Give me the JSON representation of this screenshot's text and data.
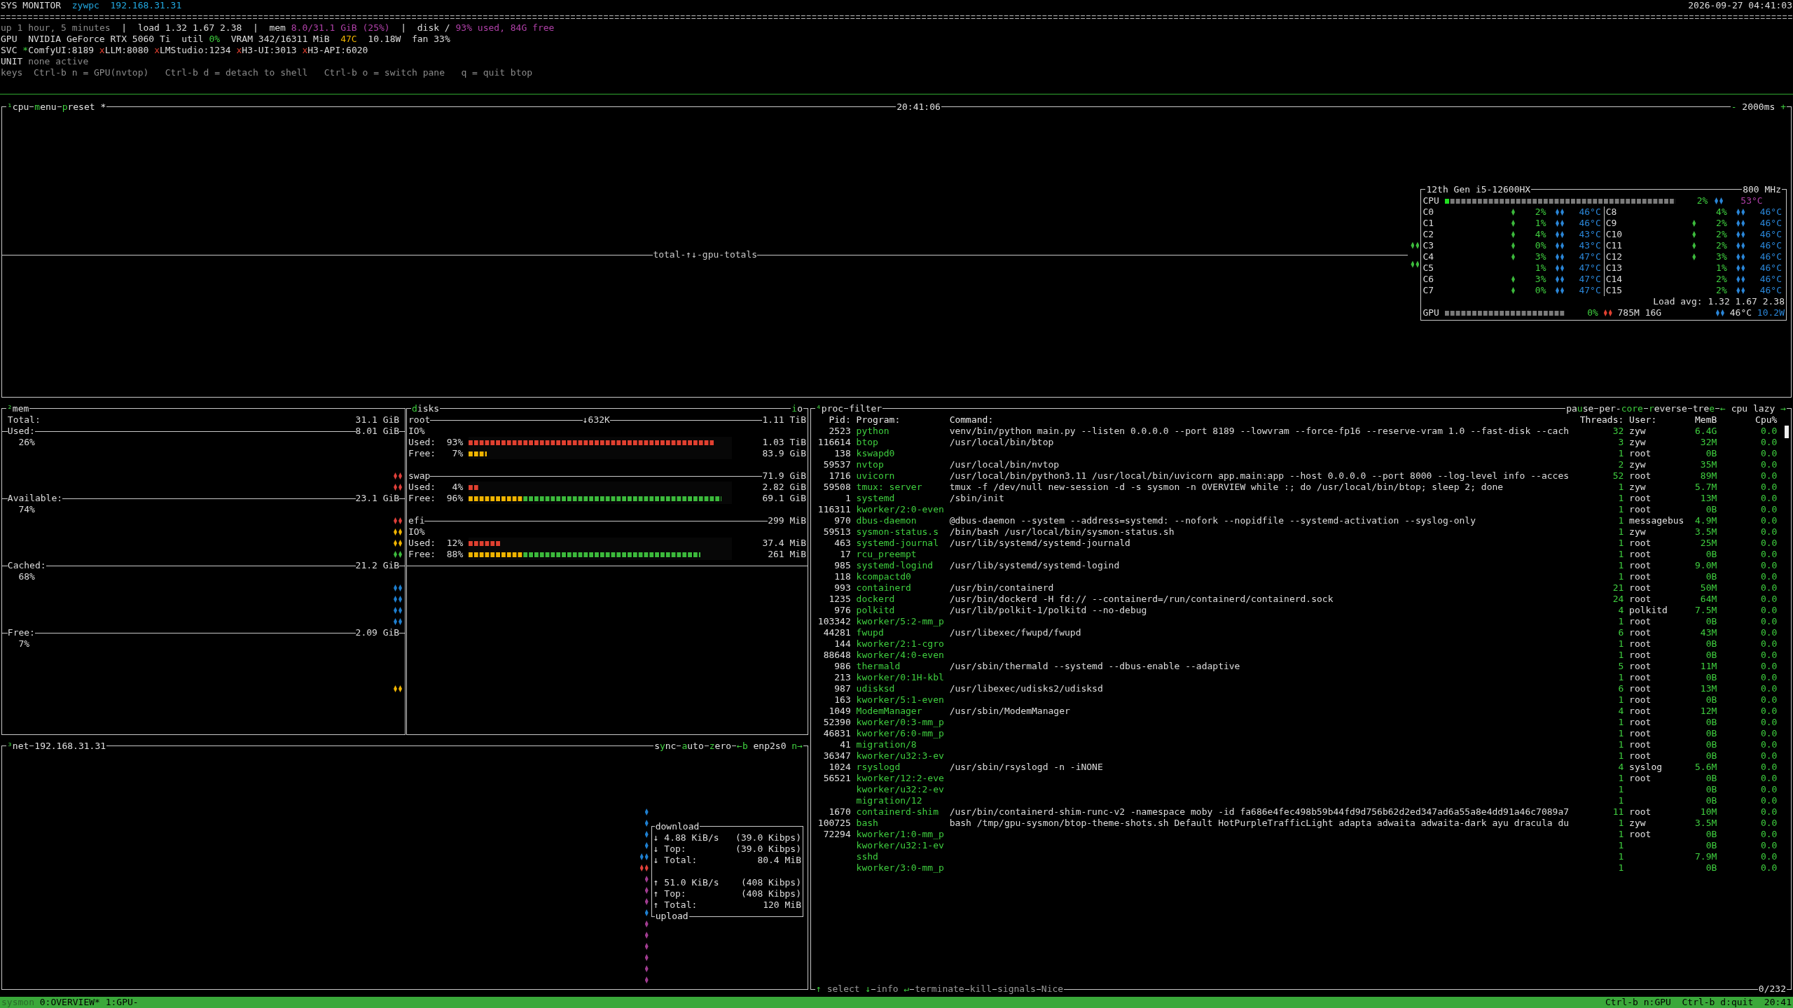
{
  "header": {
    "title": "SYS MONITOR",
    "host": "zywpc",
    "ip": "192.168.31.31",
    "datetime": "2026-09-27 04:41:03"
  },
  "summary": [
    {
      "kind": "dim",
      "text": "up 1 hour, 5 minutes"
    },
    {
      "kind": "sep",
      "text": "|"
    },
    {
      "kind": "plain",
      "text": "load 1.32 1.67 2.38"
    },
    {
      "kind": "sep",
      "text": "|"
    },
    {
      "kind": "plain",
      "text": "mem"
    },
    {
      "kind": "accent",
      "text": "8.0/31.1 GiB (25%)"
    },
    {
      "kind": "sep",
      "text": "|"
    },
    {
      "kind": "plain",
      "text": "disk /"
    },
    {
      "kind": "accent",
      "text": "93% used, 84G free"
    }
  ],
  "gpu_line": {
    "label": "GPU",
    "model": "NVIDIA GeForce RTX 5060 Ti",
    "util_label": "util",
    "util": "0%",
    "vram": "VRAM 342/16311 MiB",
    "temp": "47C",
    "power": "10.18W",
    "fan": "fan 33%"
  },
  "services": {
    "label": "SVC",
    "items": [
      {
        "mark": "*",
        "name": "ComfyUI:8189",
        "running": true
      },
      {
        "mark": "x",
        "name": "LLM:8080",
        "running": false
      },
      {
        "mark": "x",
        "name": "LMStudio:1234",
        "running": false
      },
      {
        "mark": "x",
        "name": "H3-UI:3013",
        "running": false
      },
      {
        "mark": "x",
        "name": "H3-API:6020",
        "running": false
      }
    ]
  },
  "unit": {
    "label": "UNIT",
    "value": "none active"
  },
  "keys": {
    "label": "keys",
    "items": [
      "Ctrl-b n = GPU(nvtop)",
      "Ctrl-b d = detach to shell",
      "Ctrl-b o = switch pane",
      "q = quit btop"
    ]
  },
  "cpu": {
    "tabs": [
      {
        "parts": [
          {
            "text": "¹",
            "hot": true
          },
          {
            "text": "cpu",
            "hot": false
          }
        ]
      },
      {
        "parts": [
          {
            "text": "m",
            "hot": true
          },
          {
            "text": "enu",
            "hot": false
          }
        ]
      },
      {
        "parts": [
          {
            "text": "p",
            "hot": true
          },
          {
            "text": "reset *",
            "hot": false
          }
        ]
      }
    ],
    "time": "20:41:06",
    "right_tabs": [
      {
        "parts": [
          {
            "text": "-",
            "hot": true
          },
          {
            "text": " 2000ms ",
            "hot": false
          },
          {
            "text": "+",
            "hot": true
          }
        ]
      }
    ],
    "graph_label": "total-↑↓-gpu-totals",
    "graph_marks": [
      {
        "color": "#3cba3c",
        "pair": true
      },
      {
        "color": "#3cba3c",
        "pair": true
      }
    ],
    "info": {
      "model": "12th Gen i5-12600HX",
      "freq": "800 MHz",
      "total": {
        "label": "CPU",
        "level": 0.02,
        "pct": "2%",
        "temp": "53°C"
      },
      "cores": [
        {
          "name": "C0",
          "active": true,
          "pct": "2%",
          "temp": "46°C"
        },
        {
          "name": "C1",
          "active": true,
          "pct": "1%",
          "temp": "46°C"
        },
        {
          "name": "C2",
          "active": true,
          "pct": "4%",
          "temp": "43°C"
        },
        {
          "name": "C3",
          "active": true,
          "pct": "0%",
          "temp": "43°C"
        },
        {
          "name": "C4",
          "active": true,
          "pct": "3%",
          "temp": "47°C"
        },
        {
          "name": "C5",
          "active": false,
          "pct": "1%",
          "temp": "47°C"
        },
        {
          "name": "C6",
          "active": true,
          "pct": "3%",
          "temp": "47°C"
        },
        {
          "name": "C7",
          "active": true,
          "pct": "0%",
          "temp": "47°C"
        },
        {
          "name": "C8",
          "active": false,
          "pct": "4%",
          "temp": "46°C"
        },
        {
          "name": "C9",
          "active": true,
          "pct": "2%",
          "temp": "46°C"
        },
        {
          "name": "C10",
          "active": true,
          "pct": "2%",
          "temp": "46°C"
        },
        {
          "name": "C11",
          "active": true,
          "pct": "2%",
          "temp": "46°C"
        },
        {
          "name": "C12",
          "active": true,
          "pct": "3%",
          "temp": "46°C"
        },
        {
          "name": "C13",
          "active": false,
          "pct": "1%",
          "temp": "46°C"
        },
        {
          "name": "C14",
          "active": false,
          "pct": "2%",
          "temp": "46°C"
        },
        {
          "name": "C15",
          "active": false,
          "pct": "2%",
          "temp": "46°C"
        }
      ],
      "load": "Load avg: 1.32 1.67 2.38",
      "gpu": {
        "label": "GPU",
        "pct": "0%",
        "mem": "785M 16G",
        "temp": "46°C",
        "power": "10.2W"
      }
    }
  },
  "mem": {
    "tabs": [
      {
        "parts": [
          {
            "text": "²",
            "hot": true
          },
          {
            "text": "mem",
            "hot": false
          }
        ]
      }
    ],
    "lines": [
      {
        "kind": "total",
        "label": "Total:",
        "value": "31.1 GiB"
      },
      {
        "kind": "stat",
        "label": "Used:",
        "value": "8.01 GiB"
      },
      {
        "kind": "pct",
        "text": "26%"
      },
      {
        "kind": "gap"
      },
      {
        "kind": "gap"
      },
      {
        "kind": "marks",
        "marks": [
          {
            "color": "#e0403a",
            "pair": true
          }
        ]
      },
      {
        "kind": "marks",
        "marks": [
          {
            "color": "#e0403a",
            "pair": true
          }
        ]
      },
      {
        "kind": "stat",
        "label": "Available:",
        "value": "23.1 GiB"
      },
      {
        "kind": "pct",
        "text": "74%"
      },
      {
        "kind": "marks",
        "marks": [
          {
            "color": "#e0403a",
            "pair": true
          }
        ]
      },
      {
        "kind": "marks",
        "marks": [
          {
            "color": "#f0b400",
            "pair": true
          }
        ]
      },
      {
        "kind": "marks",
        "marks": [
          {
            "color": "#f0b400",
            "pair": true
          }
        ]
      },
      {
        "kind": "marks",
        "marks": [
          {
            "color": "#3cba3c",
            "pair": true
          }
        ]
      },
      {
        "kind": "stat",
        "label": "Cached:",
        "value": "21.2 GiB"
      },
      {
        "kind": "pct",
        "text": "68%"
      },
      {
        "kind": "marks",
        "marks": [
          {
            "color": "#1e7fd0",
            "pair": true
          }
        ]
      },
      {
        "kind": "marks",
        "marks": [
          {
            "color": "#1e7fd0",
            "pair": true
          }
        ]
      },
      {
        "kind": "marks",
        "marks": [
          {
            "color": "#1e7fd0",
            "pair": true
          }
        ]
      },
      {
        "kind": "marks",
        "marks": [
          {
            "color": "#1e7fd0",
            "pair": true
          }
        ]
      },
      {
        "kind": "stat",
        "label": "Free:",
        "value": "2.09 GiB"
      },
      {
        "kind": "pct",
        "text": "7%"
      },
      {
        "kind": "gap"
      },
      {
        "kind": "gap"
      },
      {
        "kind": "gap"
      },
      {
        "kind": "marks",
        "marks": [
          {
            "color": "#f0b400",
            "pair": true
          }
        ]
      }
    ]
  },
  "disks": {
    "tabs": [
      {
        "parts": [
          {
            "text": "d",
            "hot": true
          },
          {
            "text": "isks",
            "hot": false
          }
        ]
      }
    ],
    "right_tabs": [
      {
        "parts": [
          {
            "text": "i",
            "hot": true
          },
          {
            "text": "o",
            "hot": false
          }
        ]
      }
    ],
    "items": [
      {
        "name": "root",
        "io": "↓632K",
        "size": "1.11 TiB",
        "io_label": "IO%",
        "used": {
          "label": "Used:",
          "pct": "93%",
          "level": 0.93,
          "value": "1.03 TiB"
        },
        "free": {
          "label": "Free:",
          "pct": "7%",
          "level": 0.07,
          "value": "83.9 GiB"
        }
      },
      {
        "name": "swap",
        "size": "71.9 GiB",
        "used": {
          "label": "Used:",
          "pct": "4%",
          "level": 0.04,
          "value": "2.82 GiB"
        },
        "free": {
          "label": "Free:",
          "pct": "96%",
          "level": 0.96,
          "value": "69.1 GiB"
        }
      },
      {
        "name": "efi",
        "size": "299 MiB",
        "io_label": "IO%",
        "used": {
          "label": "Used:",
          "pct": "12%",
          "level": 0.12,
          "value": "37.4 MiB"
        },
        "free": {
          "label": "Free:",
          "pct": "88%",
          "level": 0.88,
          "value": "261 MiB"
        }
      }
    ]
  },
  "net": {
    "tabs": [
      {
        "parts": [
          {
            "text": "³",
            "hot": true
          },
          {
            "text": "net",
            "hot": false
          }
        ]
      },
      {
        "parts": [
          {
            "text": "192.168.31.31",
            "hot": false
          }
        ]
      }
    ],
    "right_tabs": [
      {
        "parts": [
          {
            "text": "s",
            "hot": false
          },
          {
            "text": "y",
            "hot": true
          },
          {
            "text": "nc",
            "hot": false
          }
        ]
      },
      {
        "parts": [
          {
            "text": "a",
            "hot": true
          },
          {
            "text": "uto",
            "hot": false
          }
        ]
      },
      {
        "parts": [
          {
            "text": "z",
            "hot": true
          },
          {
            "text": "ero",
            "hot": false
          }
        ]
      },
      {
        "parts": [
          {
            "text": "←b",
            "hot": true
          },
          {
            "text": " enp2s0 ",
            "hot": false
          },
          {
            "text": "n→",
            "hot": true
          }
        ]
      }
    ],
    "marks": [
      {
        "color": "#1e7fd0",
        "pair": false
      },
      {
        "color": "#1e7fd0",
        "pair": false
      },
      {
        "color": "#1e7fd0",
        "pair": false
      },
      {
        "color": "#1e7fd0",
        "pair": false
      },
      {
        "color": "#1e7fd0",
        "pair": true
      },
      {
        "color": "#e0403a",
        "pair": true
      },
      {
        "color": "#a03c90",
        "pair": false
      },
      {
        "color": "#a03c90",
        "pair": false
      },
      {
        "color": "#a03c90",
        "pair": false
      },
      {
        "color": "#1e7fd0",
        "pair": false
      },
      {
        "color": "#a03c90",
        "pair": false
      },
      {
        "color": "#a03c90",
        "pair": false
      },
      {
        "color": "#a03c90",
        "pair": false
      },
      {
        "color": "#a03c90",
        "pair": false
      },
      {
        "color": "#a03c90",
        "pair": false
      },
      {
        "color": "#a03c90",
        "pair": false
      }
    ],
    "download": {
      "title": "download",
      "rows": [
        {
          "arrow": "↓",
          "label": "4.88 KiB/s",
          "value": "(39.0 Kibps)"
        },
        {
          "arrow": "↓",
          "label": "Top:",
          "value": "(39.0 Kibps)"
        },
        {
          "arrow": "↓",
          "label": "Total:",
          "value": "80.4 MiB"
        }
      ]
    },
    "upload": {
      "title": "upload",
      "rows": [
        {
          "arrow": "↑",
          "label": "51.0 KiB/s",
          "value": "(408 Kibps)"
        },
        {
          "arrow": "↑",
          "label": "Top:",
          "value": "(408 Kibps)"
        },
        {
          "arrow": "↑",
          "label": "Total:",
          "value": "120 MiB"
        }
      ]
    }
  },
  "proc": {
    "tabs": [
      {
        "parts": [
          {
            "text": "⁴",
            "hot": true
          },
          {
            "text": "proc",
            "hot": false
          }
        ]
      },
      {
        "parts": [
          {
            "text": "filter",
            "hot": false
          }
        ]
      }
    ],
    "right_tabs": [
      {
        "parts": [
          {
            "text": "pa",
            "hot": false
          },
          {
            "text": "u",
            "hot": true
          },
          {
            "text": "se",
            "hot": false
          }
        ]
      },
      {
        "parts": [
          {
            "text": "per-",
            "hot": false
          },
          {
            "text": "core",
            "hot": true
          }
        ]
      },
      {
        "parts": [
          {
            "text": "r",
            "hot": true
          },
          {
            "text": "everse",
            "hot": false
          }
        ]
      },
      {
        "parts": [
          {
            "text": "tre",
            "hot": false
          },
          {
            "text": "e",
            "hot": true
          }
        ]
      },
      {
        "parts": [
          {
            "text": "←",
            "hot": true
          },
          {
            "text": " cpu lazy ",
            "hot": false
          },
          {
            "text": "→",
            "hot": true
          }
        ]
      }
    ],
    "columns": [
      "Pid:",
      "Program:",
      "Command:",
      "Threads:",
      "User:",
      "MemB",
      "Cpu%"
    ],
    "rows": [
      {
        "pid": "2523",
        "program": "python",
        "command": "venv/bin/python main.py --listen 0.0.0.0 --port 8189 --lowvram --force-fp16 --reserve-vram 1.0 --fast-disk --cach",
        "threads": "32",
        "user": "zyw",
        "mem": "6.4G",
        "cpu": "0.0"
      },
      {
        "pid": "116614",
        "program": "btop",
        "command": "/usr/local/bin/btop",
        "threads": "3",
        "user": "zyw",
        "mem": "32M",
        "cpu": "0.0"
      },
      {
        "pid": "138",
        "program": "kswapd0",
        "threads": "1",
        "user": "root",
        "mem": "0B",
        "cpu": "0.0"
      },
      {
        "pid": "59537",
        "program": "nvtop",
        "command": "/usr/local/bin/nvtop",
        "threads": "2",
        "user": "zyw",
        "mem": "35M",
        "cpu": "0.0"
      },
      {
        "pid": "1716",
        "program": "uvicorn",
        "command": "/usr/local/bin/python3.11 /usr/local/bin/uvicorn app.main:app --host 0.0.0.0 --port 8000 --log-level info --acces",
        "threads": "52",
        "user": "root",
        "mem": "89M",
        "cpu": "0.0"
      },
      {
        "pid": "59508",
        "program": "tmux: server",
        "command": "tmux -f /dev/null new-session -d -s sysmon -n OVERVIEW while :; do /usr/local/bin/btop; sleep 2; done",
        "threads": "1",
        "user": "zyw",
        "mem": "5.7M",
        "cpu": "0.0"
      },
      {
        "pid": "1",
        "program": "systemd",
        "command": "/sbin/init",
        "threads": "1",
        "user": "root",
        "mem": "13M",
        "cpu": "0.0"
      },
      {
        "pid": "116311",
        "program": "kworker/2:0-even",
        "threads": "1",
        "user": "root",
        "mem": "0B",
        "cpu": "0.0"
      },
      {
        "pid": "970",
        "program": "dbus-daemon",
        "command": "@dbus-daemon --system --address=systemd: --nofork --nopidfile --systemd-activation --syslog-only",
        "threads": "1",
        "user": "messagebus",
        "mem": "4.9M",
        "cpu": "0.0"
      },
      {
        "pid": "59513",
        "program": "sysmon-status.s",
        "command": "/bin/bash /usr/local/bin/sysmon-status.sh",
        "threads": "1",
        "user": "zyw",
        "mem": "3.5M",
        "cpu": "0.0"
      },
      {
        "pid": "463",
        "program": "systemd-journal",
        "command": "/usr/lib/systemd/systemd-journald",
        "threads": "1",
        "user": "root",
        "mem": "25M",
        "cpu": "0.0"
      },
      {
        "pid": "17",
        "program": "rcu_preempt",
        "threads": "1",
        "user": "root",
        "mem": "0B",
        "cpu": "0.0"
      },
      {
        "pid": "985",
        "program": "systemd-logind",
        "command": "/usr/lib/systemd/systemd-logind",
        "threads": "1",
        "user": "root",
        "mem": "9.0M",
        "cpu": "0.0"
      },
      {
        "pid": "118",
        "program": "kcompactd0",
        "threads": "1",
        "user": "root",
        "mem": "0B",
        "cpu": "0.0"
      },
      {
        "pid": "993",
        "program": "containerd",
        "command": "/usr/bin/containerd",
        "threads": "21",
        "user": "root",
        "mem": "50M",
        "cpu": "0.0"
      },
      {
        "pid": "1235",
        "program": "dockerd",
        "command": "/usr/bin/dockerd -H fd:// --containerd=/run/containerd/containerd.sock",
        "threads": "24",
        "user": "root",
        "mem": "64M",
        "cpu": "0.0"
      },
      {
        "pid": "976",
        "program": "polkitd",
        "command": "/usr/lib/polkit-1/polkitd --no-debug",
        "threads": "4",
        "user": "polkitd",
        "mem": "7.5M",
        "cpu": "0.0"
      },
      {
        "pid": "103342",
        "program": "kworker/5:2-mm_p",
        "threads": "1",
        "user": "root",
        "mem": "0B",
        "cpu": "0.0"
      },
      {
        "pid": "44281",
        "program": "fwupd",
        "command": "/usr/libexec/fwupd/fwupd",
        "threads": "6",
        "user": "root",
        "mem": "43M",
        "cpu": "0.0"
      },
      {
        "pid": "144",
        "program": "kworker/2:1-cgro",
        "threads": "1",
        "user": "root",
        "mem": "0B",
        "cpu": "0.0"
      },
      {
        "pid": "88648",
        "program": "kworker/4:0-even",
        "threads": "1",
        "user": "root",
        "mem": "0B",
        "cpu": "0.0"
      },
      {
        "pid": "986",
        "program": "thermald",
        "command": "/usr/sbin/thermald --systemd --dbus-enable --adaptive",
        "threads": "5",
        "user": "root",
        "mem": "11M",
        "cpu": "0.0"
      },
      {
        "pid": "213",
        "program": "kworker/0:1H-kbl",
        "threads": "1",
        "user": "root",
        "mem": "0B",
        "cpu": "0.0"
      },
      {
        "pid": "987",
        "program": "udisksd",
        "command": "/usr/libexec/udisks2/udisksd",
        "threads": "6",
        "user": "root",
        "mem": "13M",
        "cpu": "0.0"
      },
      {
        "pid": "163",
        "program": "kworker/5:1-even",
        "threads": "1",
        "user": "root",
        "mem": "0B",
        "cpu": "0.0"
      },
      {
        "pid": "1049",
        "program": "ModemManager",
        "command": "/usr/sbin/ModemManager",
        "threads": "4",
        "user": "root",
        "mem": "12M",
        "cpu": "0.0"
      },
      {
        "pid": "52390",
        "program": "kworker/0:3-mm_p",
        "threads": "1",
        "user": "root",
        "mem": "0B",
        "cpu": "0.0"
      },
      {
        "pid": "46831",
        "program": "kworker/6:0-mm_p",
        "threads": "1",
        "user": "root",
        "mem": "0B",
        "cpu": "0.0"
      },
      {
        "pid": "41",
        "program": "migration/8",
        "threads": "1",
        "user": "root",
        "mem": "0B",
        "cpu": "0.0"
      },
      {
        "pid": "36347",
        "program": "kworker/u32:3-ev",
        "threads": "1",
        "user": "root",
        "mem": "0B",
        "cpu": "0.0"
      },
      {
        "pid": "1024",
        "program": "rsyslogd",
        "command": "/usr/sbin/rsyslogd -n -iNONE",
        "threads": "4",
        "user": "syslog",
        "mem": "5.6M",
        "cpu": "0.0"
      },
      {
        "pid": "56521",
        "program": "kworker/12:2-eve",
        "threads": "1",
        "user": "root",
        "mem": "0B",
        "cpu": "0.0"
      },
      {
        "program": "kworker/u32:2-ev",
        "threads": "1",
        "mem": "0B",
        "cpu": "0.0"
      },
      {
        "program": "migration/12",
        "threads": "1",
        "mem": "0B",
        "cpu": "0.0"
      },
      {
        "pid": "1670",
        "program": "containerd-shim",
        "command": "/usr/bin/containerd-shim-runc-v2 -namespace moby -id fa686e4fec498b59b44fd9d756b62d2ed347ad6a55a8e4dd91a46c7089a7",
        "threads": "11",
        "user": "root",
        "mem": "10M",
        "cpu": "0.0"
      },
      {
        "pid": "100725",
        "program": "bash",
        "command": "bash /tmp/gpu-sysmon/btop-theme-shots.sh Default HotPurpleTrafficLight adapta adwaita adwaita-dark ayu dracula du",
        "threads": "1",
        "user": "zyw",
        "mem": "3.5M",
        "cpu": "0.0"
      },
      {
        "pid": "72294",
        "program": "kworker/1:0-mm_p",
        "threads": "1",
        "user": "root",
        "mem": "0B",
        "cpu": "0.0"
      },
      {
        "program": "kworker/u32:1-ev",
        "threads": "1",
        "mem": "0B",
        "cpu": "0.0"
      },
      {
        "program": "sshd",
        "threads": "1",
        "mem": "7.9M",
        "cpu": "0.0"
      },
      {
        "program": "kworker/3:0-mm_p",
        "threads": "1",
        "mem": "0B",
        "cpu": "0.0"
      }
    ],
    "footer": [
      {
        "parts": [
          {
            "text": "↑",
            "hot": true
          },
          {
            "text": " select ",
            "hot": false
          },
          {
            "text": "↓",
            "hot": true
          }
        ]
      },
      {
        "parts": [
          {
            "text": "info ",
            "hot": false
          },
          {
            "text": "↵",
            "hot": true
          }
        ]
      },
      {
        "parts": [
          {
            "text": "terminate",
            "hot": false
          }
        ]
      },
      {
        "parts": [
          {
            "text": "kill",
            "hot": false
          }
        ]
      },
      {
        "parts": [
          {
            "text": "signals",
            "hot": false
          }
        ]
      },
      {
        "parts": [
          {
            "text": "Nice",
            "hot": false
          }
        ]
      }
    ],
    "count": "0/232"
  },
  "tmux_bar": {
    "session": "sysmon",
    "windows": [
      "0:OVERVIEW*",
      "1:GPU-"
    ],
    "right": [
      "Ctrl-b n:GPU",
      "Ctrl-b d:quit",
      "20:41"
    ]
  }
}
